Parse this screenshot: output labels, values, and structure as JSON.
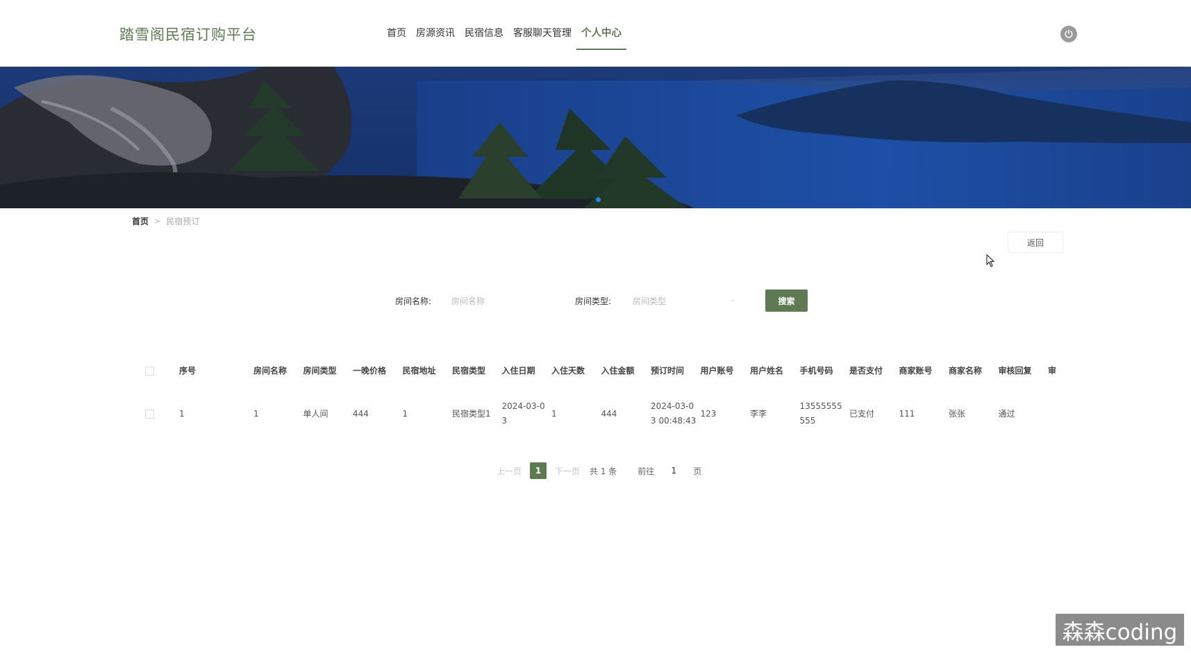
{
  "header": {
    "brand": "踏雪阁民宿订购平台",
    "nav": [
      {
        "label": "首页",
        "active": false
      },
      {
        "label": "房源资讯",
        "active": false
      },
      {
        "label": "民宿信息",
        "active": false
      },
      {
        "label": "客服聊天管理",
        "active": false
      },
      {
        "label": "个人中心",
        "active": true
      }
    ],
    "power_icon": "power-icon"
  },
  "breadcrumb": {
    "home": "首页",
    "separator": ">",
    "current": "民宿预订"
  },
  "back_label": "返回",
  "search": {
    "room_name_label": "房间名称:",
    "room_name_placeholder": "房间名称",
    "room_type_label": "房间类型:",
    "room_type_placeholder": "房间类型",
    "button": "搜索"
  },
  "table": {
    "columns": [
      "序号",
      "房间名称",
      "房间类型",
      "一晚价格",
      "民宿地址",
      "民宿类型",
      "入住日期",
      "入住天数",
      "入住金额",
      "预订时间",
      "用户账号",
      "用户姓名",
      "手机号码",
      "是否支付",
      "商家账号",
      "商家名称",
      "审核回复",
      "审"
    ],
    "rows": [
      [
        "1",
        "1",
        "单人间",
        "444",
        "1",
        "民宿类型1",
        "2024-03-03",
        "1",
        "444",
        "2024-03-03 00:48:43",
        "123",
        "李李",
        "13555555555",
        "已支付",
        "111",
        "张张",
        "通过",
        ""
      ]
    ]
  },
  "pagination": {
    "prev": "上一页",
    "current": "1",
    "next": "下一页",
    "total": "共 1 条",
    "goto": "前往",
    "goto_value": "1",
    "unit": "页"
  },
  "watermark": "森森coding",
  "colors": {
    "accent": "#5d7a52",
    "banner_dot": "#1e88e5"
  }
}
